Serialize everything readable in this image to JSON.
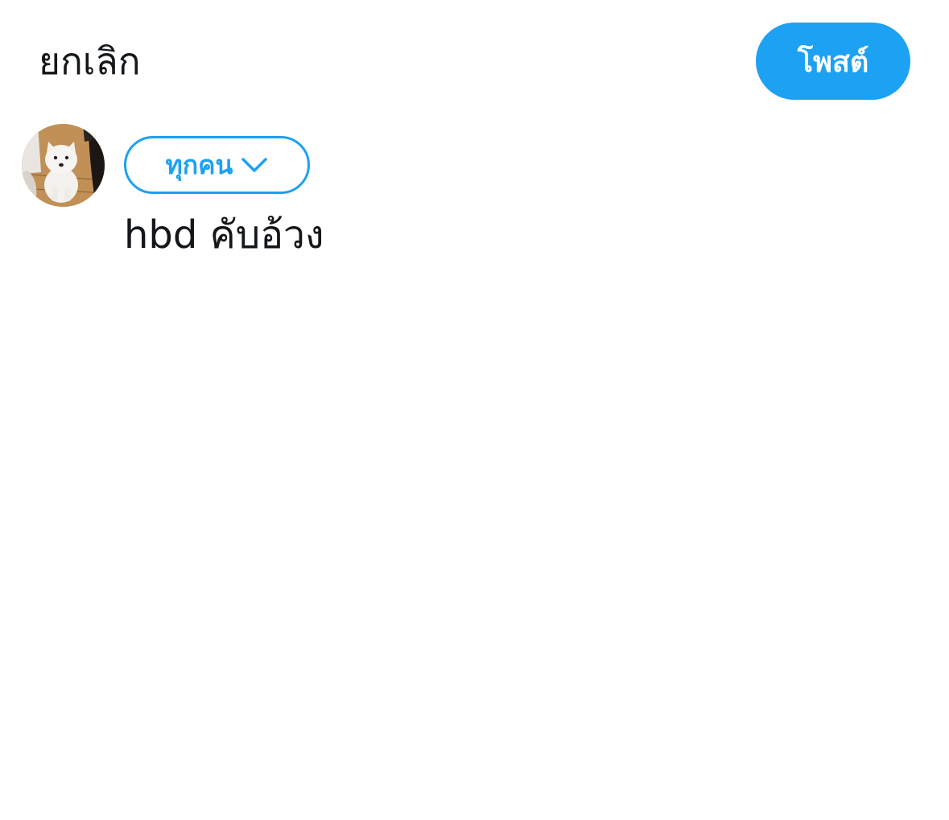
{
  "header": {
    "cancel_label": "ยกเลิก",
    "post_label": "โพสต์"
  },
  "composer": {
    "avatar_icon": "avatar-white-dog",
    "audience_label": "ทุกคน",
    "audience_icon": "chevron-down-icon",
    "tweet_text": "hbd คับอ้วง"
  },
  "colors": {
    "accent": "#1da1f2",
    "text": "#14171a",
    "background": "#ffffff"
  }
}
